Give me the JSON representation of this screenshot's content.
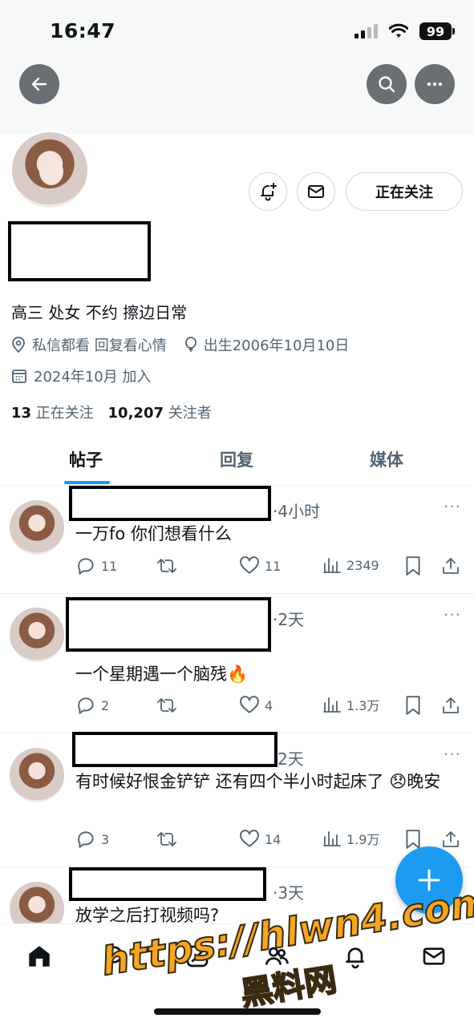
{
  "status_bar": {
    "time": "16:47",
    "battery": "99"
  },
  "profile": {
    "follow_button": "正在关注",
    "bio": "高三 处女 不约 擦边日常",
    "location": "私信都看 回复看心情",
    "birthday": "出生2006年10月10日",
    "joined": "2024年10月 加入",
    "following_count": "13",
    "following_label": "正在关注",
    "followers_count": "10,207",
    "followers_label": "关注者"
  },
  "tabs": [
    {
      "label": "帖子",
      "active": true
    },
    {
      "label": "回复",
      "active": false
    },
    {
      "label": "媒体",
      "active": false
    }
  ],
  "tweets": [
    {
      "time": "·4小时",
      "text": "一万fo 你们想看什么",
      "replies": "11",
      "retweets": "",
      "likes": "11",
      "views": "2349"
    },
    {
      "time": "·2天",
      "text": "一个星期遇一个脑残🔥",
      "replies": "2",
      "retweets": "",
      "likes": "4",
      "views": "1.3万"
    },
    {
      "time": "2天",
      "text": "有时候好恨金铲铲 还有四个半小时起床了 😞晚安",
      "replies": "3",
      "retweets": "",
      "likes": "14",
      "views": "1.9万"
    },
    {
      "time": "·3天",
      "text": "放学之后打视频吗?",
      "replies": "",
      "retweets": "",
      "likes": "",
      "views": ""
    }
  ],
  "more_label": "···",
  "watermark": {
    "line1": "https://hlwn4.com",
    "line2": "黑料网"
  },
  "colors": {
    "accent": "#1d9bf0",
    "text": "#0f1419",
    "muted": "#536471",
    "watermark": "#f5a623"
  },
  "icons": {
    "back": "arrow-left-icon",
    "search": "search-icon",
    "more": "more-icon",
    "notify": "bell-plus-icon",
    "message": "envelope-icon",
    "location": "location-pin-icon",
    "birthday": "balloon-icon",
    "calendar": "calendar-icon"
  }
}
